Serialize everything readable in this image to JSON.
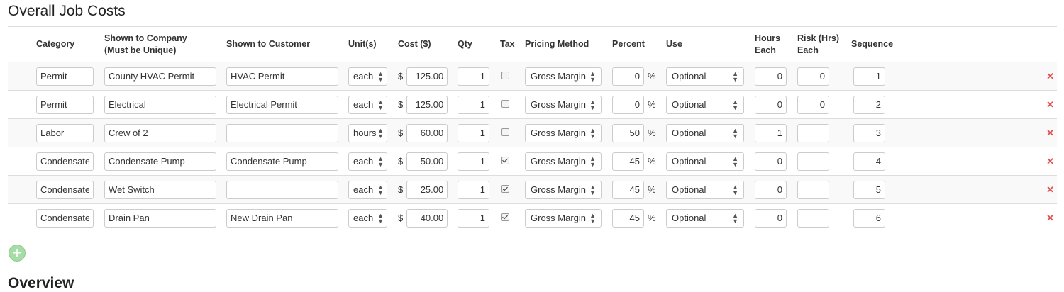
{
  "title": "Overall Job Costs",
  "next_section_title": "Overview",
  "headers": {
    "category": "Category",
    "company_1": "Shown to Company",
    "company_2": "(Must be Unique)",
    "customer": "Shown to Customer",
    "units": "Unit(s)",
    "cost": "Cost ($)",
    "qty": "Qty",
    "tax": "Tax",
    "pricing": "Pricing Method",
    "percent": "Percent",
    "use": "Use",
    "hours_1": "Hours",
    "hours_2": "Each",
    "risk_1": "Risk (Hrs)",
    "risk_2": "Each",
    "sequence": "Sequence"
  },
  "currency_symbol": "$",
  "percent_symbol": "%",
  "rows": [
    {
      "category": "Permit",
      "company": "County HVAC Permit",
      "customer": "HVAC Permit",
      "unit": "each",
      "cost": "125.00",
      "qty": "1",
      "tax": false,
      "pricing": "Gross Margin",
      "percent": "0",
      "use": "Optional",
      "hours": "0",
      "risk": "0",
      "sequence": "1"
    },
    {
      "category": "Permit",
      "company": "Electrical",
      "customer": "Electrical Permit",
      "unit": "each",
      "cost": "125.00",
      "qty": "1",
      "tax": false,
      "pricing": "Gross Margin",
      "percent": "0",
      "use": "Optional",
      "hours": "0",
      "risk": "0",
      "sequence": "2"
    },
    {
      "category": "Labor",
      "company": "Crew of 2",
      "customer": "",
      "unit": "hours",
      "cost": "60.00",
      "qty": "1",
      "tax": false,
      "pricing": "Gross Margin",
      "percent": "50",
      "use": "Optional",
      "hours": "1",
      "risk": "",
      "sequence": "3"
    },
    {
      "category": "Condensate",
      "company": "Condensate Pump",
      "customer": "Condensate Pump",
      "unit": "each",
      "cost": "50.00",
      "qty": "1",
      "tax": true,
      "pricing": "Gross Margin",
      "percent": "45",
      "use": "Optional",
      "hours": "0",
      "risk": "",
      "sequence": "4"
    },
    {
      "category": "Condensate",
      "company": "Wet Switch",
      "customer": "",
      "unit": "each",
      "cost": "25.00",
      "qty": "1",
      "tax": true,
      "pricing": "Gross Margin",
      "percent": "45",
      "use": "Optional",
      "hours": "0",
      "risk": "",
      "sequence": "5"
    },
    {
      "category": "Condensate",
      "company": "Drain Pan",
      "customer": "New Drain Pan",
      "unit": "each",
      "cost": "40.00",
      "qty": "1",
      "tax": true,
      "pricing": "Gross Margin",
      "percent": "45",
      "use": "Optional",
      "hours": "0",
      "risk": "",
      "sequence": "6"
    }
  ],
  "icons": {
    "delete": "close-icon",
    "add": "plus-circle-icon"
  },
  "colors": {
    "delete": "#e05252",
    "add": "#a6dca6"
  }
}
